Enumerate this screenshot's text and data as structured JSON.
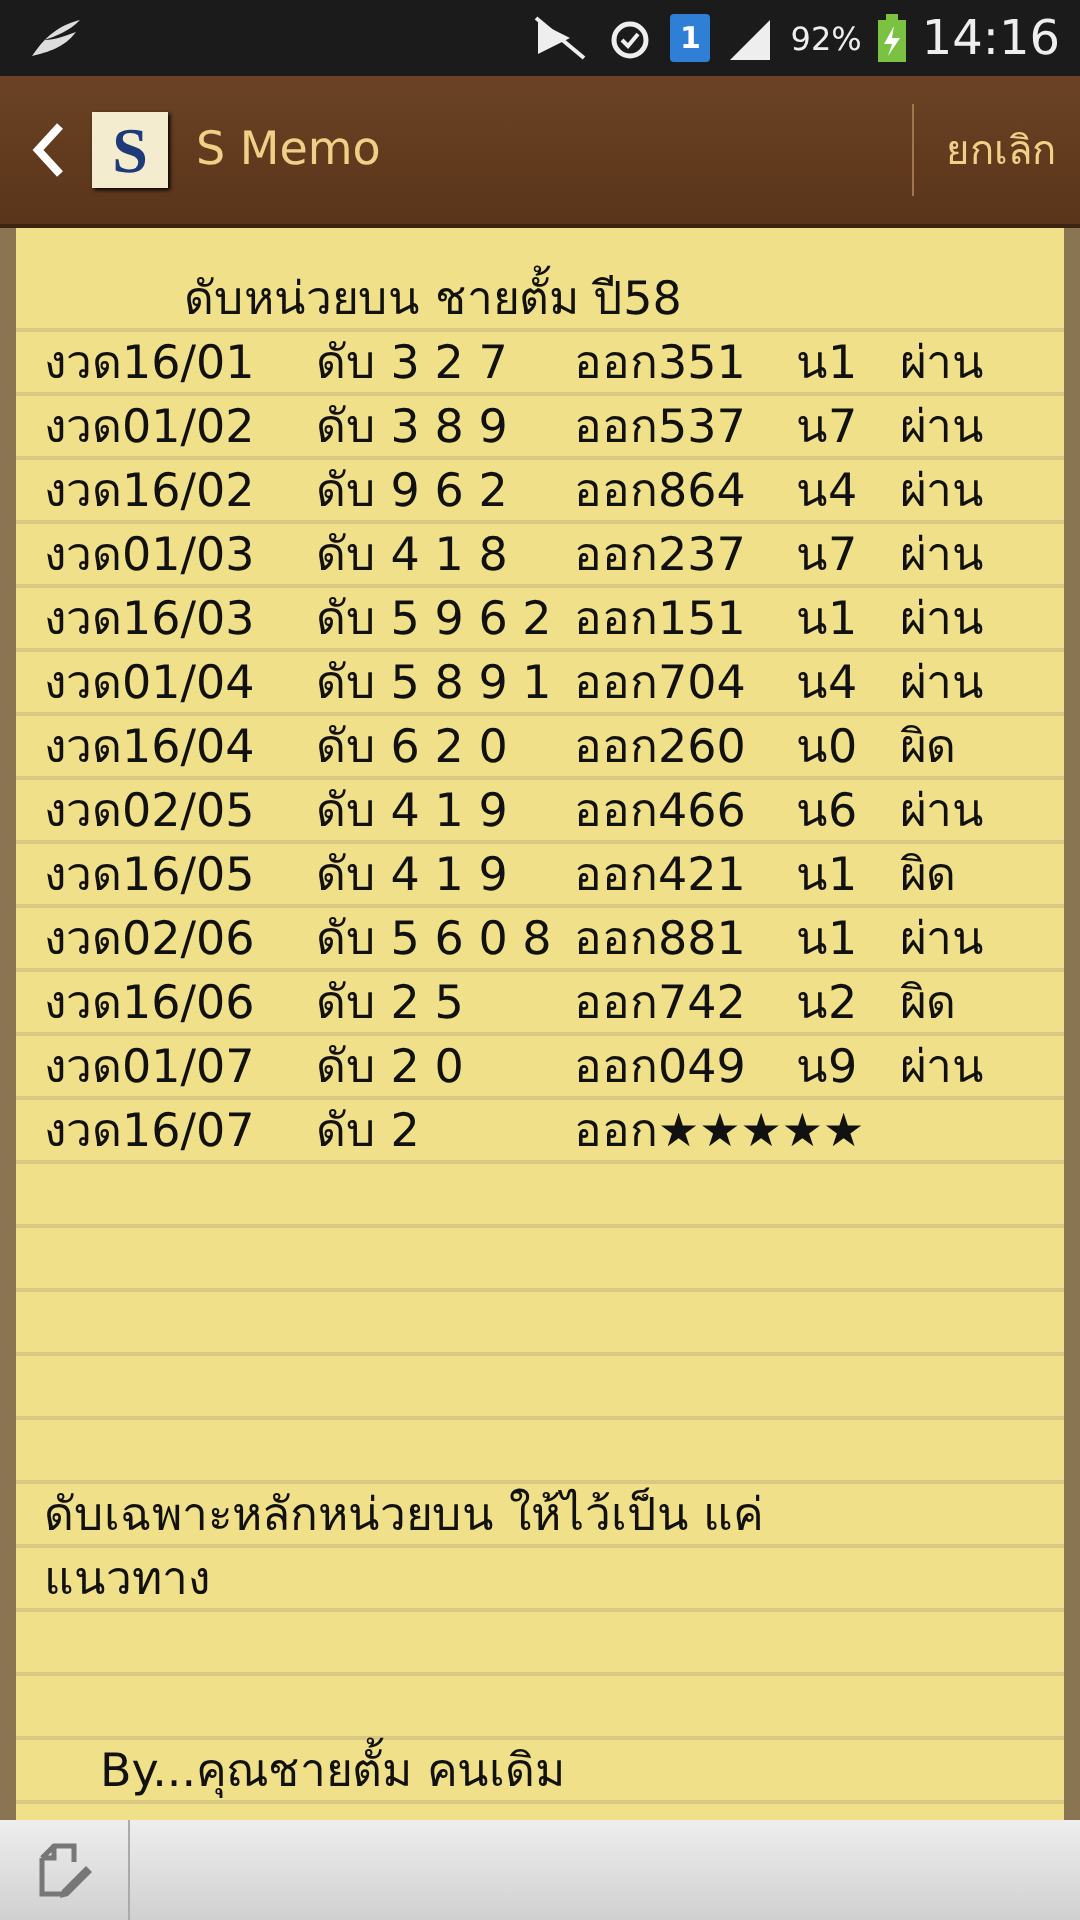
{
  "status_bar": {
    "notification_badge": "1",
    "battery": "92%",
    "time": "14:16"
  },
  "action_bar": {
    "logo_letter": "S",
    "title": "S Memo",
    "cancel": "ยกเลิก"
  },
  "memo": {
    "title": "ดับหน่วยบน  ชายตั้ม  ปี58",
    "rows": [
      {
        "period": "งวด16/01",
        "guess": "ดับ 3 2 7",
        "result": "ออก351",
        "unit": "น1",
        "verdict": "ผ่าน"
      },
      {
        "period": "งวด01/02",
        "guess": "ดับ 3 8 9",
        "result": "ออก537",
        "unit": "น7",
        "verdict": "ผ่าน"
      },
      {
        "period": "งวด16/02",
        "guess": "ดับ 9 6 2",
        "result": "ออก864",
        "unit": "น4",
        "verdict": "ผ่าน"
      },
      {
        "period": "งวด01/03",
        "guess": "ดับ 4 1 8",
        "result": "ออก237",
        "unit": "น7",
        "verdict": "ผ่าน"
      },
      {
        "period": "งวด16/03",
        "guess": "ดับ 5 9 6 2",
        "result": "ออก151",
        "unit": "น1",
        "verdict": "ผ่าน"
      },
      {
        "period": "งวด01/04",
        "guess": "ดับ 5 8 9 1",
        "result": "ออก704",
        "unit": "น4",
        "verdict": "ผ่าน"
      },
      {
        "period": "งวด16/04",
        "guess": "ดับ 6 2 0",
        "result": "ออก260",
        "unit": "น0",
        "verdict": "ผิด"
      },
      {
        "period": "งวด02/05",
        "guess": "ดับ 4 1 9",
        "result": "ออก466",
        "unit": "น6",
        "verdict": "ผ่าน"
      },
      {
        "period": "งวด16/05",
        "guess": "ดับ 4 1 9",
        "result": "ออก421",
        "unit": "น1",
        "verdict": "ผิด"
      },
      {
        "period": "งวด02/06",
        "guess": "ดับ 5 6 0 8",
        "result": "ออก881",
        "unit": "น1",
        "verdict": "ผ่าน"
      },
      {
        "period": "งวด16/06",
        "guess": "ดับ 2 5",
        "result": "ออก742",
        "unit": "น2",
        "verdict": "ผิด"
      },
      {
        "period": "งวด01/07",
        "guess": "ดับ 2 0",
        "result": "ออก049",
        "unit": "น9",
        "verdict": "ผ่าน"
      },
      {
        "period": "งวด16/07",
        "guess": "ดับ 2",
        "result": "ออก★★★★★"
      }
    ],
    "note": "ดับเฉพาะหลักหน่วยบน  ให้ไว้เป็น แค่แนวทาง",
    "byline": "By...คุณชายตั้ม  คนเดิม"
  }
}
